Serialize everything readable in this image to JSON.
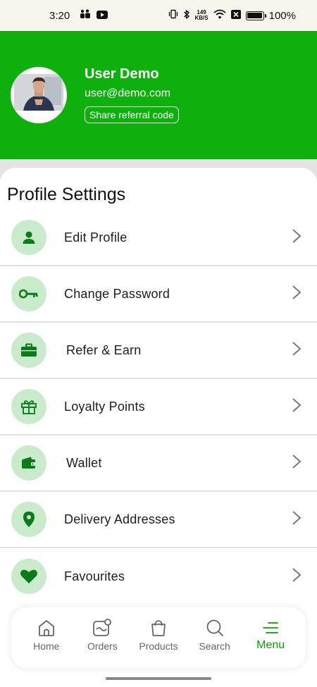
{
  "status_bar": {
    "time": "3:20",
    "net_speed_value": "149",
    "net_speed_unit": "KB/S",
    "battery": "100%"
  },
  "header": {
    "name": "User Demo",
    "email": "user@demo.com",
    "referral_button": "Share referral code",
    "background_color": "#0db00d"
  },
  "settings": {
    "title": "Profile Settings",
    "items": [
      {
        "label": "Edit Profile",
        "icon": "person-icon"
      },
      {
        "label": "Change Password",
        "icon": "key-icon"
      },
      {
        "label": "Refer & Earn",
        "icon": "briefcase-icon"
      },
      {
        "label": "Loyalty Points",
        "icon": "gift-icon"
      },
      {
        "label": "Wallet",
        "icon": "wallet-icon"
      },
      {
        "label": "Delivery Addresses",
        "icon": "location-pin-icon"
      },
      {
        "label": "Favourites",
        "icon": "heart-icon"
      }
    ]
  },
  "bottom_nav": {
    "items": [
      {
        "label": "Home",
        "icon": "home-icon"
      },
      {
        "label": "Orders",
        "icon": "orders-icon"
      },
      {
        "label": "Products",
        "icon": "shopping-bag-icon"
      },
      {
        "label": "Search",
        "icon": "search-icon"
      },
      {
        "label": "Menu",
        "icon": "menu-icon",
        "active": true
      }
    ],
    "active_color": "#0a9a0a"
  }
}
